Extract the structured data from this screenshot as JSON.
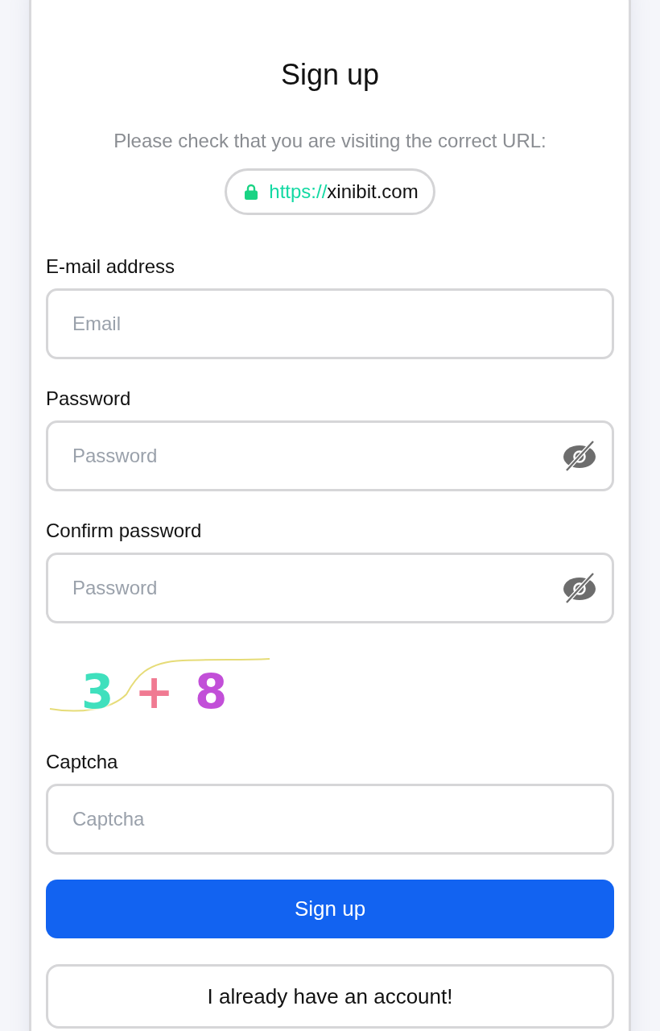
{
  "title": "Sign up",
  "notice": {
    "text": "Please check that you are visiting the correct URL:",
    "url": {
      "scheme": "https://",
      "domain": "xinibit.com"
    }
  },
  "fields": [
    {
      "kind": "text",
      "label": "E-mail address",
      "placeholder": "Email"
    },
    {
      "kind": "password",
      "label": "Password",
      "placeholder": "Password"
    },
    {
      "kind": "password",
      "label": "Confirm password",
      "placeholder": "Password"
    }
  ],
  "captcha": {
    "glyphs": [
      {
        "char": "3",
        "color": "#3fe0bd"
      },
      {
        "char": "+",
        "color": "#f07a92"
      },
      {
        "char": "8",
        "color": "#c24fd8"
      }
    ],
    "label": "Captcha",
    "placeholder": "Captcha"
  },
  "buttons": [
    {
      "kind": "primary",
      "label": "Sign up"
    },
    {
      "kind": "secondary",
      "label": "I already have an account!"
    }
  ]
}
